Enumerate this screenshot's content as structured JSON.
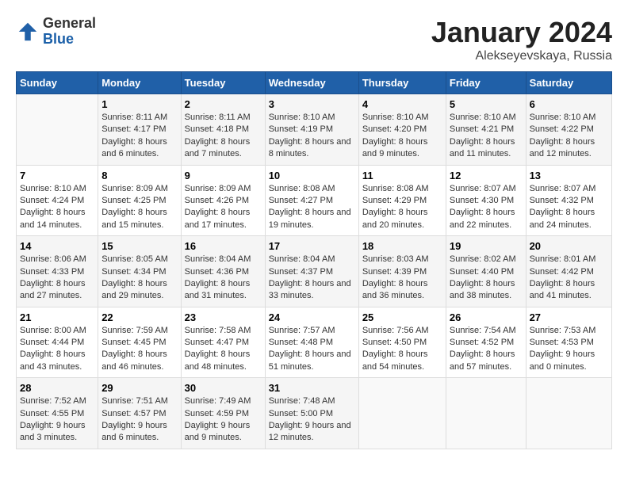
{
  "header": {
    "logo": {
      "general": "General",
      "blue": "Blue"
    },
    "title": "January 2024",
    "location": "Alekseyevskaya, Russia"
  },
  "weekdays": [
    "Sunday",
    "Monday",
    "Tuesday",
    "Wednesday",
    "Thursday",
    "Friday",
    "Saturday"
  ],
  "weeks": [
    [
      {
        "day": "",
        "content": ""
      },
      {
        "day": "1",
        "sunrise": "8:11 AM",
        "sunset": "4:17 PM",
        "daylight": "8 hours and 6 minutes."
      },
      {
        "day": "2",
        "sunrise": "8:11 AM",
        "sunset": "4:18 PM",
        "daylight": "8 hours and 7 minutes."
      },
      {
        "day": "3",
        "sunrise": "8:10 AM",
        "sunset": "4:19 PM",
        "daylight": "8 hours and 8 minutes."
      },
      {
        "day": "4",
        "sunrise": "8:10 AM",
        "sunset": "4:20 PM",
        "daylight": "8 hours and 9 minutes."
      },
      {
        "day": "5",
        "sunrise": "8:10 AM",
        "sunset": "4:21 PM",
        "daylight": "8 hours and 11 minutes."
      },
      {
        "day": "6",
        "sunrise": "8:10 AM",
        "sunset": "4:22 PM",
        "daylight": "8 hours and 12 minutes."
      }
    ],
    [
      {
        "day": "7",
        "sunrise": "8:10 AM",
        "sunset": "4:24 PM",
        "daylight": "8 hours and 14 minutes."
      },
      {
        "day": "8",
        "sunrise": "8:09 AM",
        "sunset": "4:25 PM",
        "daylight": "8 hours and 15 minutes."
      },
      {
        "day": "9",
        "sunrise": "8:09 AM",
        "sunset": "4:26 PM",
        "daylight": "8 hours and 17 minutes."
      },
      {
        "day": "10",
        "sunrise": "8:08 AM",
        "sunset": "4:27 PM",
        "daylight": "8 hours and 19 minutes."
      },
      {
        "day": "11",
        "sunrise": "8:08 AM",
        "sunset": "4:29 PM",
        "daylight": "8 hours and 20 minutes."
      },
      {
        "day": "12",
        "sunrise": "8:07 AM",
        "sunset": "4:30 PM",
        "daylight": "8 hours and 22 minutes."
      },
      {
        "day": "13",
        "sunrise": "8:07 AM",
        "sunset": "4:32 PM",
        "daylight": "8 hours and 24 minutes."
      }
    ],
    [
      {
        "day": "14",
        "sunrise": "8:06 AM",
        "sunset": "4:33 PM",
        "daylight": "8 hours and 27 minutes."
      },
      {
        "day": "15",
        "sunrise": "8:05 AM",
        "sunset": "4:34 PM",
        "daylight": "8 hours and 29 minutes."
      },
      {
        "day": "16",
        "sunrise": "8:04 AM",
        "sunset": "4:36 PM",
        "daylight": "8 hours and 31 minutes."
      },
      {
        "day": "17",
        "sunrise": "8:04 AM",
        "sunset": "4:37 PM",
        "daylight": "8 hours and 33 minutes."
      },
      {
        "day": "18",
        "sunrise": "8:03 AM",
        "sunset": "4:39 PM",
        "daylight": "8 hours and 36 minutes."
      },
      {
        "day": "19",
        "sunrise": "8:02 AM",
        "sunset": "4:40 PM",
        "daylight": "8 hours and 38 minutes."
      },
      {
        "day": "20",
        "sunrise": "8:01 AM",
        "sunset": "4:42 PM",
        "daylight": "8 hours and 41 minutes."
      }
    ],
    [
      {
        "day": "21",
        "sunrise": "8:00 AM",
        "sunset": "4:44 PM",
        "daylight": "8 hours and 43 minutes."
      },
      {
        "day": "22",
        "sunrise": "7:59 AM",
        "sunset": "4:45 PM",
        "daylight": "8 hours and 46 minutes."
      },
      {
        "day": "23",
        "sunrise": "7:58 AM",
        "sunset": "4:47 PM",
        "daylight": "8 hours and 48 minutes."
      },
      {
        "day": "24",
        "sunrise": "7:57 AM",
        "sunset": "4:48 PM",
        "daylight": "8 hours and 51 minutes."
      },
      {
        "day": "25",
        "sunrise": "7:56 AM",
        "sunset": "4:50 PM",
        "daylight": "8 hours and 54 minutes."
      },
      {
        "day": "26",
        "sunrise": "7:54 AM",
        "sunset": "4:52 PM",
        "daylight": "8 hours and 57 minutes."
      },
      {
        "day": "27",
        "sunrise": "7:53 AM",
        "sunset": "4:53 PM",
        "daylight": "9 hours and 0 minutes."
      }
    ],
    [
      {
        "day": "28",
        "sunrise": "7:52 AM",
        "sunset": "4:55 PM",
        "daylight": "9 hours and 3 minutes."
      },
      {
        "day": "29",
        "sunrise": "7:51 AM",
        "sunset": "4:57 PM",
        "daylight": "9 hours and 6 minutes."
      },
      {
        "day": "30",
        "sunrise": "7:49 AM",
        "sunset": "4:59 PM",
        "daylight": "9 hours and 9 minutes."
      },
      {
        "day": "31",
        "sunrise": "7:48 AM",
        "sunset": "5:00 PM",
        "daylight": "9 hours and 12 minutes."
      },
      {
        "day": "",
        "content": ""
      },
      {
        "day": "",
        "content": ""
      },
      {
        "day": "",
        "content": ""
      }
    ]
  ],
  "labels": {
    "sunrise": "Sunrise:",
    "sunset": "Sunset:",
    "daylight": "Daylight:"
  }
}
